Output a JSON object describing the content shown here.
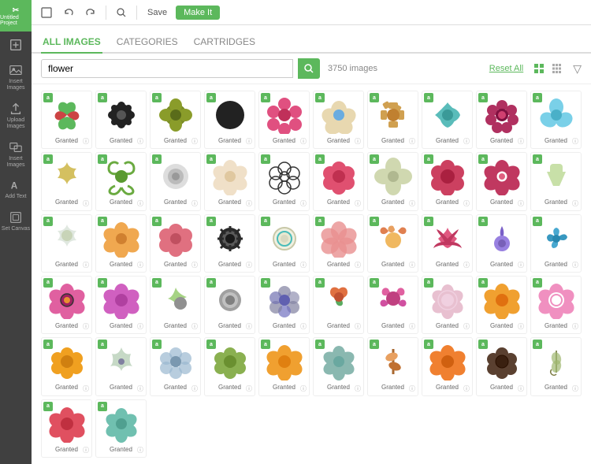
{
  "app": {
    "title": "Cricut",
    "project": "Untitled Project"
  },
  "sidebar": {
    "items": [
      {
        "label": "New",
        "icon": "new-icon"
      },
      {
        "label": "Insert Images",
        "icon": "insert-images-icon"
      },
      {
        "label": "Upload Images",
        "icon": "upload-images-icon"
      },
      {
        "label": "Insert Images",
        "icon": "insert-images-icon2"
      },
      {
        "label": "Add Text",
        "icon": "add-text-icon"
      },
      {
        "label": "Set Canvas",
        "icon": "set-canvas-icon"
      }
    ]
  },
  "tabs": {
    "items": [
      {
        "label": "ALL IMAGES",
        "active": true
      },
      {
        "label": "CATEGORIES",
        "active": false
      },
      {
        "label": "CARTRIDGES",
        "active": false
      }
    ]
  },
  "search": {
    "query": "flower",
    "placeholder": "flower",
    "results_count": "3750 images",
    "reset_label": "Reset All"
  },
  "images": {
    "granted_label": "Granted",
    "cells": [
      {
        "badge": "a",
        "label": "Granted"
      },
      {
        "badge": "a",
        "label": "Granted"
      },
      {
        "badge": "a",
        "label": "Granted"
      },
      {
        "badge": "a",
        "label": "Granted"
      },
      {
        "badge": "a",
        "label": "Granted"
      },
      {
        "badge": "a",
        "label": "Granted"
      },
      {
        "badge": "a",
        "label": "Granted"
      },
      {
        "badge": "a",
        "label": "Granted"
      },
      {
        "badge": "a",
        "label": "Granted"
      },
      {
        "badge": "a",
        "label": "Granted"
      },
      {
        "badge": "a",
        "label": "Granted"
      },
      {
        "badge": "a",
        "label": "Granted"
      },
      {
        "badge": "a",
        "label": "Granted"
      },
      {
        "badge": "a",
        "label": "Granted"
      },
      {
        "badge": "a",
        "label": "Granted"
      },
      {
        "badge": "a",
        "label": "Granted"
      },
      {
        "badge": "a",
        "label": "Granted"
      },
      {
        "badge": "a",
        "label": "Granted"
      },
      {
        "badge": "a",
        "label": "Granted"
      },
      {
        "badge": "a",
        "label": "Granted"
      },
      {
        "badge": "a",
        "label": "Granted"
      },
      {
        "badge": "a",
        "label": "Granted"
      },
      {
        "badge": "a",
        "label": "Granted"
      },
      {
        "badge": "a",
        "label": "Granted"
      },
      {
        "badge": "a",
        "label": "Granted"
      },
      {
        "badge": "a",
        "label": "Granted"
      },
      {
        "badge": "a",
        "label": "Granted"
      },
      {
        "badge": "a",
        "label": "Granted"
      },
      {
        "badge": "a",
        "label": "Granted"
      },
      {
        "badge": "a",
        "label": "Granted"
      },
      {
        "badge": "a",
        "label": "Granted"
      },
      {
        "badge": "a",
        "label": "Granted"
      },
      {
        "badge": "a",
        "label": "Granted"
      },
      {
        "badge": "a",
        "label": "Granted"
      },
      {
        "badge": "a",
        "label": "Granted"
      },
      {
        "badge": "a",
        "label": "Granted"
      },
      {
        "badge": "a",
        "label": "Granted"
      },
      {
        "badge": "a",
        "label": "Granted"
      },
      {
        "badge": "a",
        "label": "Granted"
      },
      {
        "badge": "a",
        "label": "Granted"
      },
      {
        "badge": "a",
        "label": "Granted"
      },
      {
        "badge": "a",
        "label": "Granted"
      },
      {
        "badge": "a",
        "label": "Granted"
      },
      {
        "badge": "a",
        "label": "Granted"
      },
      {
        "badge": "a",
        "label": "Granted"
      },
      {
        "badge": "a",
        "label": "Granted"
      },
      {
        "badge": "a",
        "label": "Granted"
      },
      {
        "badge": "a",
        "label": "Granted"
      },
      {
        "badge": "a",
        "label": "Granted"
      },
      {
        "badge": "a",
        "label": "Granted"
      }
    ]
  }
}
